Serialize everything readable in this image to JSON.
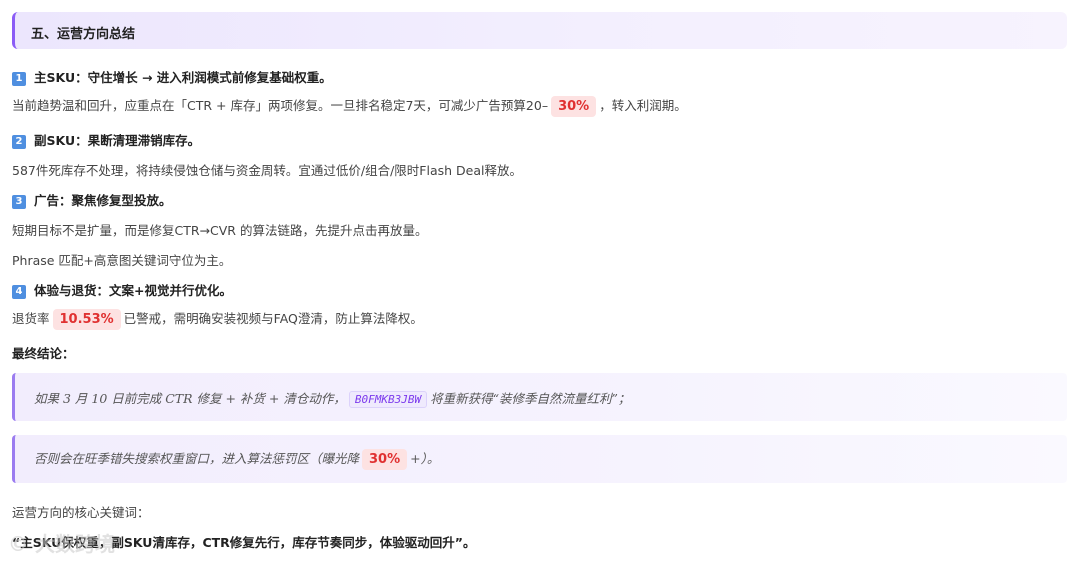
{
  "section_title": "五、运营方向总结",
  "points": [
    {
      "badge": "1",
      "heading": "主SKU：守住增长 → 进入利润模式前修复基础权重。",
      "lines": [
        {
          "pre": "当前趋势温和回升，应重点在「CTR + 库存」两项修复。一旦排名稳定7天，可减少广告预算20–",
          "highlight": "30%",
          "post": "，转入利润期。"
        }
      ]
    },
    {
      "badge": "2",
      "heading": "副SKU：果断清理滞销库存。",
      "lines": [
        {
          "text": "587件死库存不处理，将持续侵蚀仓储与资金周转。宜通过低价/组合/限时Flash Deal释放。"
        }
      ]
    },
    {
      "badge": "3",
      "heading": "广告：聚焦修复型投放。",
      "lines": [
        {
          "text": "短期目标不是扩量，而是修复CTR→CVR 的算法链路，先提升点击再放量。"
        },
        {
          "text": "Phrase 匹配+高意图关键词守位为主。"
        }
      ]
    },
    {
      "badge": "4",
      "heading": "体验与退货：文案+视觉并行优化。",
      "lines": [
        {
          "pre": "退货率",
          "highlight": "10.53%",
          "post": "已警戒，需明确安装视频与FAQ澄清，防止算法降权。"
        }
      ]
    }
  ],
  "conclusion_label": "最终结论：",
  "quotes": [
    {
      "pre": "如果 3 月 10 日前完成 CTR 修复 + 补货 + 清仓动作，",
      "code": "B0FMKB3JBW",
      "post": "将重新获得“装修季自然流量红利”；"
    },
    {
      "pre": "否则会在旺季错失搜索权重窗口，进入算法惩罚区（曝光降",
      "highlight": "30%",
      "post": "+）。"
    }
  ],
  "keywords_label": "运营方向的核心关键词：",
  "keywords_text": "“主SKU保权重，副SKU清库存，CTR修复先行，库存节奏同步，体验驱动回升”。",
  "watermark": "© 大数跨境",
  "colors": {
    "accent": "#8b5cf6",
    "highlight_bg": "#fde2e2",
    "highlight_fg": "#e03131",
    "badge": "#4f8fe0"
  }
}
